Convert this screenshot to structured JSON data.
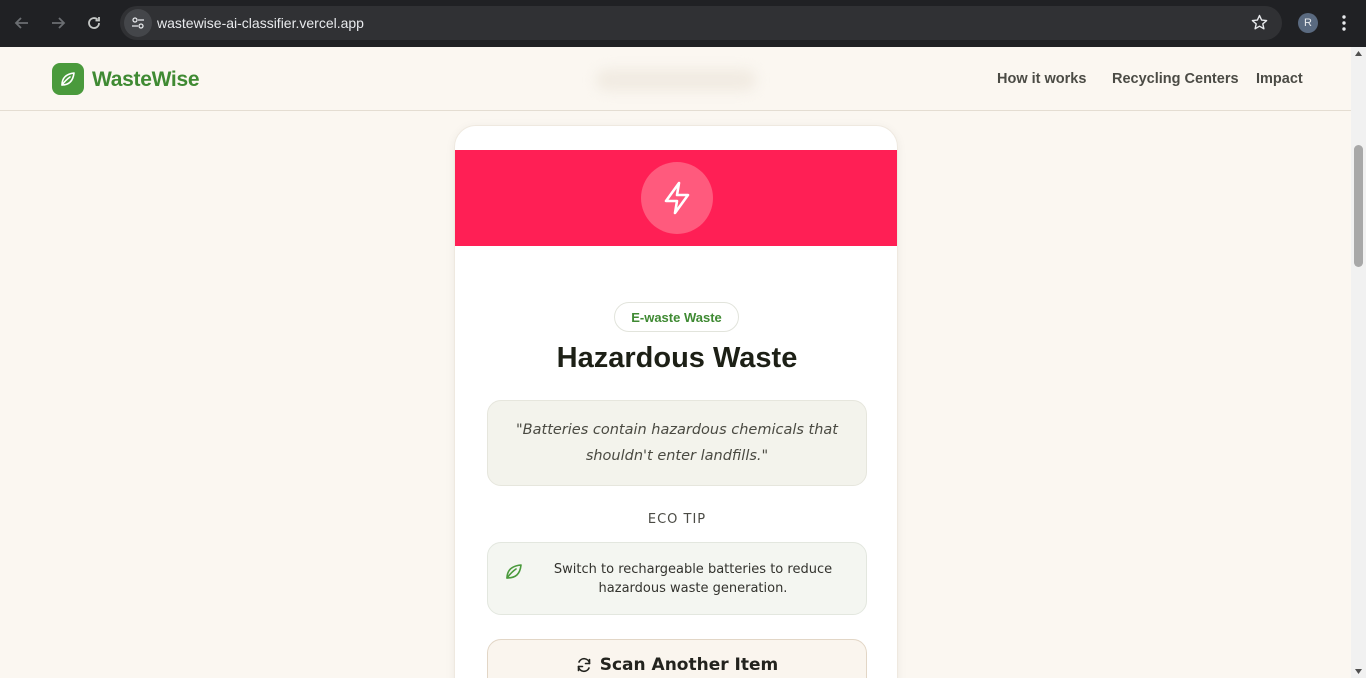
{
  "browser": {
    "url": "wastewise-ai-classifier.vercel.app",
    "profile_initial": "R"
  },
  "header": {
    "brand": "WasteWise",
    "nav": [
      "How it works",
      "Recycling Centers",
      "Impact"
    ]
  },
  "result": {
    "category": "E-waste Waste",
    "title": "Hazardous Waste",
    "reason": "\"Batteries contain hazardous chemicals that shouldn't enter landfills.\"",
    "eco_tip_heading": "ECO TIP",
    "eco_tip": "Switch to rechargeable batteries to reduce hazardous waste generation.",
    "scan_again_label": "Scan Another Item"
  },
  "colors": {
    "brand": "#4a9a3c",
    "banner": "#ff1f55",
    "page_bg": "#fbf7f1"
  },
  "icons": [
    "arrow-left-icon",
    "arrow-right-icon",
    "reload-icon",
    "tune-icon",
    "star-icon",
    "kebab-icon",
    "leaf-icon",
    "lightning-icon",
    "refresh-icon"
  ]
}
